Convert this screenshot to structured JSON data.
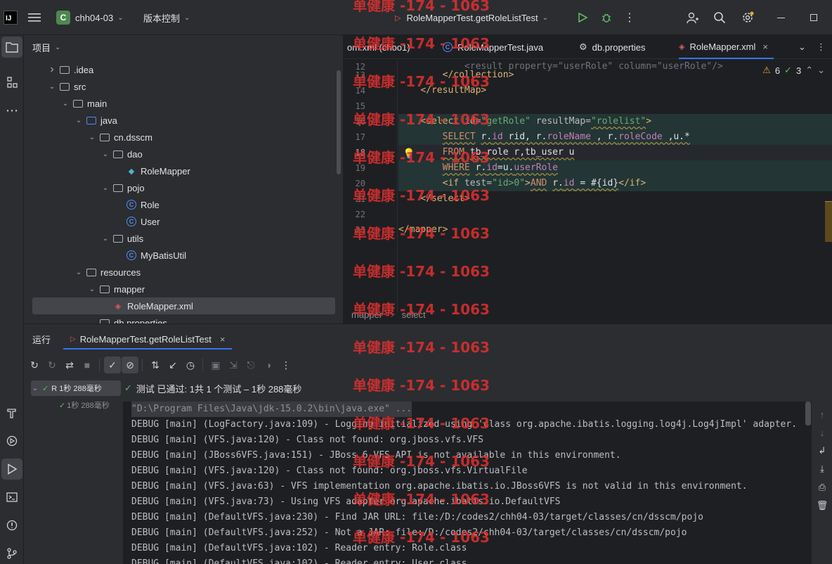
{
  "titlebar": {
    "project_initial": "C",
    "project_name": "chh04-03",
    "vcs_label": "版本控制",
    "run_config": "RoleMapperTest.getRoleListTest"
  },
  "project_panel": {
    "title": "项目",
    "tree": [
      {
        "label": ".idea",
        "type": "folder",
        "depth": 1,
        "arrow": "right"
      },
      {
        "label": "src",
        "type": "folder",
        "depth": 1,
        "arrow": "down"
      },
      {
        "label": "main",
        "type": "folder",
        "depth": 2,
        "arrow": "down"
      },
      {
        "label": "java",
        "type": "folder-blue",
        "depth": 3,
        "arrow": "down"
      },
      {
        "label": "cn.dsscm",
        "type": "package",
        "depth": 4,
        "arrow": "down"
      },
      {
        "label": "dao",
        "type": "package",
        "depth": 5,
        "arrow": "down"
      },
      {
        "label": "RoleMapper",
        "type": "mapper",
        "depth": 6,
        "arrow": ""
      },
      {
        "label": "pojo",
        "type": "package",
        "depth": 5,
        "arrow": "down"
      },
      {
        "label": "Role",
        "type": "class",
        "depth": 6,
        "arrow": ""
      },
      {
        "label": "User",
        "type": "class",
        "depth": 6,
        "arrow": ""
      },
      {
        "label": "utils",
        "type": "package",
        "depth": 5,
        "arrow": "down"
      },
      {
        "label": "MyBatisUtil",
        "type": "class",
        "depth": 6,
        "arrow": ""
      },
      {
        "label": "resources",
        "type": "folder",
        "depth": 3,
        "arrow": "down"
      },
      {
        "label": "mapper",
        "type": "folder",
        "depth": 4,
        "arrow": "down"
      },
      {
        "label": "RoleMapper.xml",
        "type": "xml",
        "depth": 5,
        "arrow": "",
        "selected": true
      },
      {
        "label": "db.properties",
        "type": "file",
        "depth": 4,
        "arrow": ""
      }
    ]
  },
  "editor": {
    "tabs": [
      {
        "label": "om.xml (choo1)",
        "icon": ""
      },
      {
        "label": "RoleMapperTest.java",
        "icon": "class"
      },
      {
        "label": "db.properties",
        "icon": "gear"
      },
      {
        "label": "RoleMapper.xml",
        "icon": "xml",
        "active": true
      }
    ],
    "inspections": {
      "warnings": "6",
      "ok": "3"
    },
    "line_numbers": [
      "12",
      "13",
      "14",
      "15",
      "16",
      "17",
      "18",
      "19",
      "20",
      "21",
      "22",
      "23"
    ],
    "breadcrumb": [
      "mapper",
      "select"
    ]
  },
  "run_panel": {
    "title": "运行",
    "tab_label": "RoleMapperTest.getRoleListTest",
    "tests_passed": "测试 已通过: 1共 1 个测试 – 1秒 288毫秒",
    "tree_root": "R 1秒 288毫秒",
    "tree_child": "1秒 288毫秒",
    "console": [
      "\"D:\\Program Files\\Java\\jdk-15.0.2\\bin\\java.exe\" ...",
      "DEBUG [main] (LogFactory.java:109) - Logging initialized using 'class org.apache.ibatis.logging.log4j.Log4jImpl' adapter.",
      "DEBUG [main] (VFS.java:120) - Class not found: org.jboss.vfs.VFS",
      "DEBUG [main] (JBoss6VFS.java:151) - JBoss 6 VFS API is not available in this environment.",
      "DEBUG [main] (VFS.java:120) - Class not found: org.jboss.vfs.VirtualFile",
      "DEBUG [main] (VFS.java:63) - VFS implementation org.apache.ibatis.io.JBoss6VFS is not valid in this environment.",
      "DEBUG [main] (VFS.java:73) - Using VFS adapter org.apache.ibatis.io.DefaultVFS",
      "DEBUG [main] (DefaultVFS.java:230) - Find JAR URL: file:/D:/codes2/chh04-03/target/classes/cn/dsscm/pojo",
      "DEBUG [main] (DefaultVFS.java:252) - Not a JAR: file:/D:/codes2/chh04-03/target/classes/cn/dsscm/pojo",
      "DEBUG [main] (DefaultVFS.java:102) - Reader entry: Role.class",
      "DEBUG [main] (DefaultVFS.java:102) - Reader entry: User.class"
    ]
  },
  "watermark": "单健康 -174 - 1063",
  "colors": {
    "accent": "#3574f0",
    "pass": "#5fb865",
    "bg": "#1e1f22",
    "panel": "#2b2d30"
  }
}
